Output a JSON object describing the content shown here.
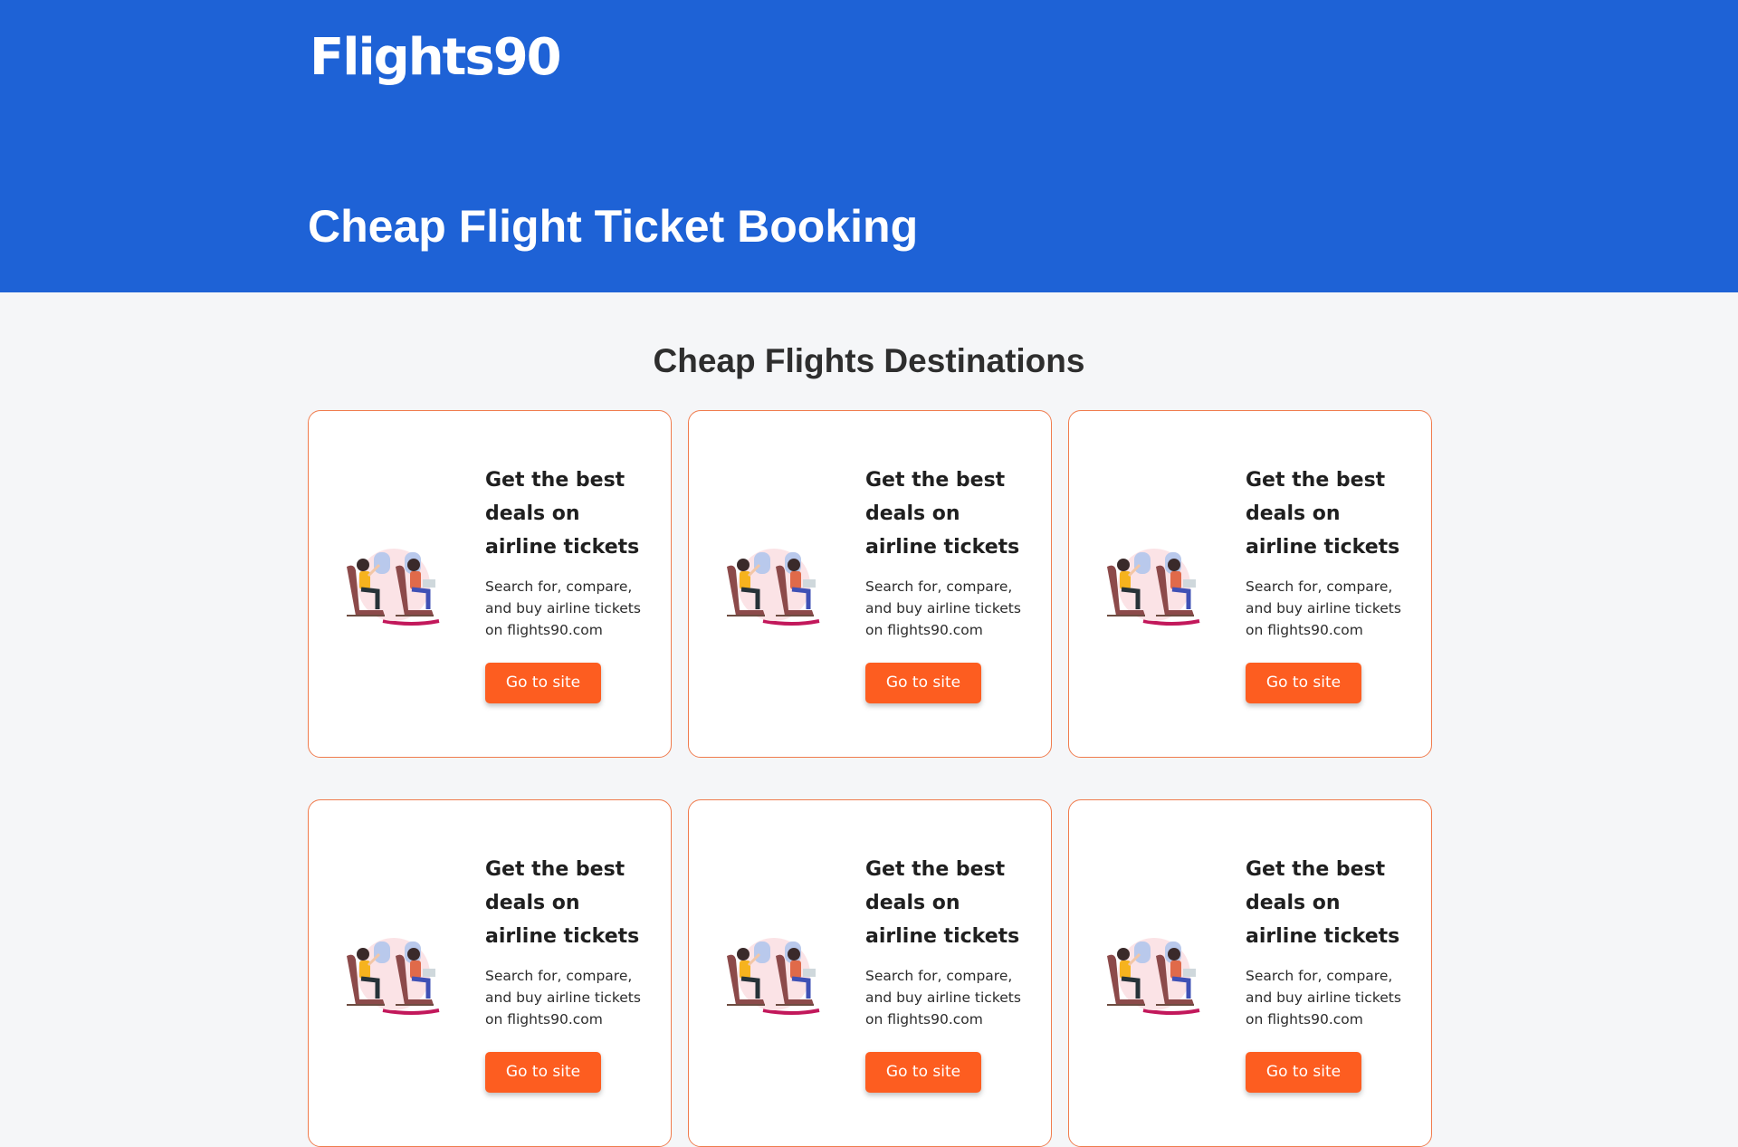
{
  "header": {
    "logo_text": "Flights90",
    "title": "Cheap Flight Ticket Booking"
  },
  "main": {
    "section_title": "Cheap Flights Destinations",
    "cards": [
      {
        "heading": "Get the best deals on airline tickets",
        "description": "Search for, compare, and buy airline tickets on flights90.com",
        "button_label": "Go to site"
      },
      {
        "heading": "Get the best deals on airline tickets",
        "description": "Search for, compare, and buy airline tickets on flights90.com",
        "button_label": "Go to site"
      },
      {
        "heading": "Get the best deals on airline tickets",
        "description": "Search for, compare, and buy airline tickets on flights90.com",
        "button_label": "Go to site"
      },
      {
        "heading": "Get the best deals on airline tickets",
        "description": "Search for, compare, and buy airline tickets on flights90.com",
        "button_label": "Go to site"
      },
      {
        "heading": "Get the best deals on airline tickets",
        "description": "Search for, compare, and buy airline tickets on flights90.com",
        "button_label": "Go to site"
      },
      {
        "heading": "Get the best deals on airline tickets",
        "description": "Search for, compare, and buy airline tickets on flights90.com",
        "button_label": "Go to site"
      }
    ]
  },
  "colors": {
    "header_blue": "#1e62d6",
    "button_orange": "#fd5d20",
    "card_border": "#f07c4e",
    "page_background": "#f5f6f8"
  },
  "icons": {
    "card_illustration": "airplane-passengers-illustration"
  }
}
